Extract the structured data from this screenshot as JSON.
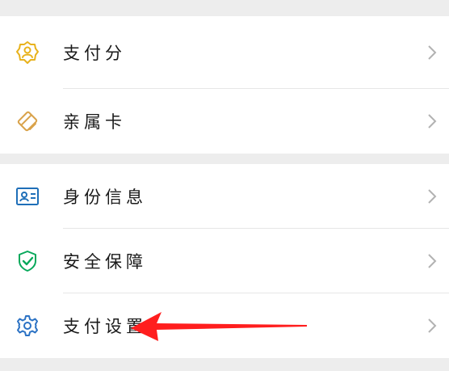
{
  "group1": {
    "items": [
      {
        "label": "支付分",
        "icon": "payment-score-icon"
      },
      {
        "label": "亲属卡",
        "icon": "family-card-icon"
      }
    ]
  },
  "group2": {
    "items": [
      {
        "label": "身份信息",
        "icon": "id-card-icon"
      },
      {
        "label": "安全保障",
        "icon": "shield-check-icon"
      },
      {
        "label": "支付设置",
        "icon": "gear-icon"
      }
    ]
  },
  "annotation": {
    "type": "red-arrow",
    "points_to": "支付设置",
    "color": "#ff1e1e"
  },
  "colors": {
    "background": "#ededed",
    "card": "#ffffff",
    "payment_score": "#e8b21c",
    "family_card": "#d9a24a",
    "id_card": "#1f6fb8",
    "shield": "#07a85b",
    "gear": "#2b72c4",
    "chevron": "#b2b2b2"
  }
}
